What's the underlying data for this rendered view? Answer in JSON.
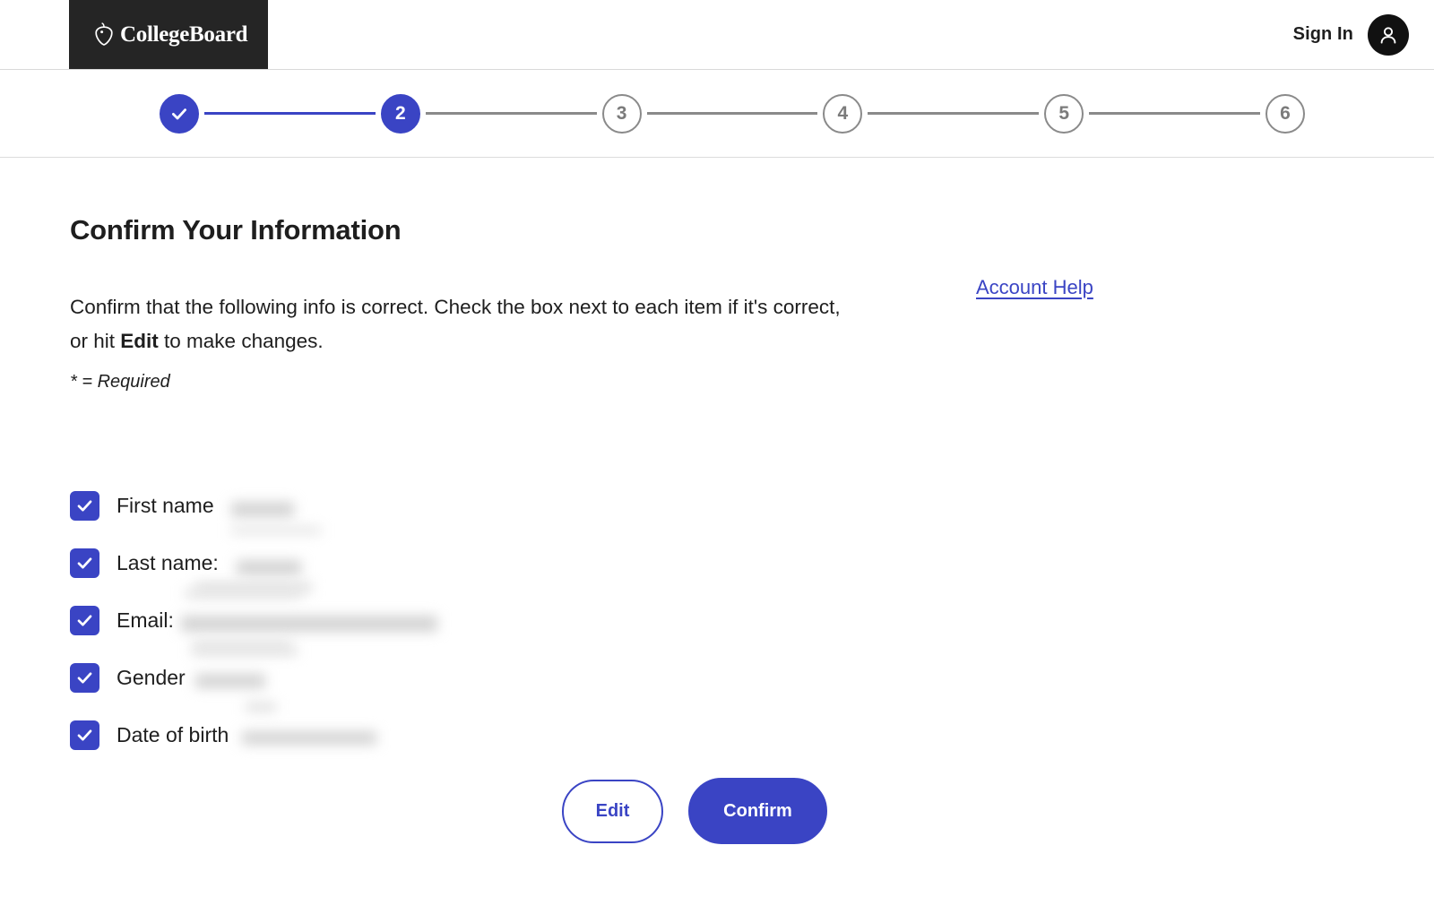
{
  "header": {
    "logo_text": "CollegeBoard",
    "logo_icon": "acorn-icon",
    "sign_in_label": "Sign In",
    "avatar_icon": "user-avatar-icon"
  },
  "stepper": {
    "steps": [
      {
        "label": "1",
        "state": "done",
        "icon": "check-icon"
      },
      {
        "label": "2",
        "state": "active"
      },
      {
        "label": "3",
        "state": "todo"
      },
      {
        "label": "4",
        "state": "todo"
      },
      {
        "label": "5",
        "state": "todo"
      },
      {
        "label": "6",
        "state": "todo"
      }
    ]
  },
  "main": {
    "title": "Confirm Your Information",
    "intro_part1": "Confirm that the following info is correct. Check the box next to each item if it's correct, or hit ",
    "intro_bold": "Edit",
    "intro_part2": " to make changes.",
    "required_note": "* = Required",
    "account_help_label": "Account Help"
  },
  "checklist": {
    "items": [
      {
        "label": "First name",
        "checked": true,
        "value": ""
      },
      {
        "label": "Last name:",
        "checked": true,
        "value": ""
      },
      {
        "label": "Email:",
        "checked": true,
        "value": ""
      },
      {
        "label": "Gender",
        "checked": true,
        "value": ""
      },
      {
        "label": "Date of birth",
        "checked": true,
        "value": ""
      }
    ]
  },
  "actions": {
    "edit_label": "Edit",
    "confirm_label": "Confirm"
  },
  "colors": {
    "brand_blue": "#3a44c4",
    "logo_background": "#252525",
    "text": "#1e1e1e",
    "step_inactive": "#8a8a8a"
  }
}
